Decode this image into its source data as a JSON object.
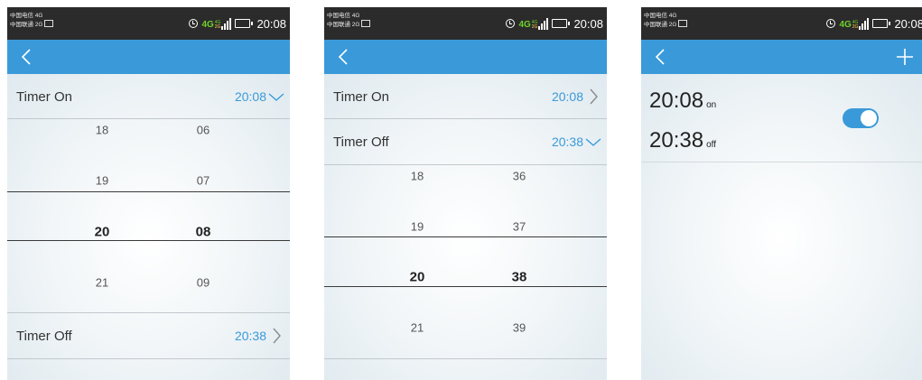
{
  "status_bar": {
    "carrier_line1": "中国电信 4G",
    "carrier_line2": "中国联通 2G",
    "network_main": "4G",
    "network_mini_top": "4G",
    "network_mini_bottom": "2G",
    "time": "20:08",
    "icons": [
      "alarm-icon",
      "sim-icon",
      "signal-icon",
      "battery-icon"
    ]
  },
  "screens": [
    {
      "nav": {
        "back_icon": "chevron-left-icon"
      },
      "timer_on": {
        "label": "Timer On",
        "value": "20:08",
        "state_icon": "chevron-down-icon"
      },
      "picker": {
        "hours": [
          "18",
          "19",
          "20",
          "21"
        ],
        "minutes": [
          "06",
          "07",
          "08",
          "09"
        ],
        "selected_hour": "20",
        "selected_minute": "08"
      },
      "timer_off": {
        "label": "Timer Off",
        "value": "20:38",
        "state_icon": "chevron-right-icon"
      }
    },
    {
      "nav": {
        "back_icon": "chevron-left-icon"
      },
      "timer_on": {
        "label": "Timer On",
        "value": "20:08",
        "state_icon": "chevron-right-icon"
      },
      "timer_off": {
        "label": "Timer Off",
        "value": "20:38",
        "state_icon": "chevron-down-icon"
      },
      "picker": {
        "hours": [
          "18",
          "19",
          "20",
          "21"
        ],
        "minutes": [
          "36",
          "37",
          "38",
          "39"
        ],
        "selected_hour": "20",
        "selected_minute": "38"
      }
    },
    {
      "nav": {
        "back_icon": "chevron-left-icon",
        "add_icon": "plus-icon"
      },
      "timer": {
        "on_time": "20:08",
        "on_label": "on",
        "off_time": "20:38",
        "off_label": "off",
        "enabled": true
      }
    }
  ],
  "colors": {
    "accent": "#3a9ad9",
    "status_bar": "#2b2b2b",
    "network_green": "#6fd22b"
  }
}
